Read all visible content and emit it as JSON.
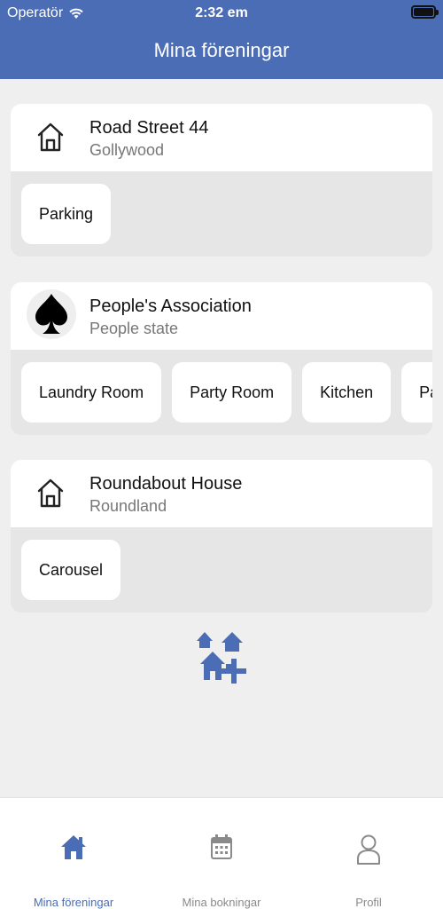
{
  "status_bar": {
    "carrier": "Operatör",
    "time": "2:32 em"
  },
  "header": {
    "title": "Mina föreningar"
  },
  "associations": [
    {
      "name": "Road Street 44",
      "location": "Gollywood",
      "icon": "house-icon",
      "resources": [
        "Parking"
      ]
    },
    {
      "name": "People's Association",
      "location": "People state",
      "icon": "spade-icon",
      "resources": [
        "Laundry Room",
        "Party Room",
        "Kitchen",
        "Par"
      ]
    },
    {
      "name": "Roundabout House",
      "location": "Roundland",
      "icon": "house-icon",
      "resources": [
        "Carousel"
      ]
    }
  ],
  "add_button": {
    "icon": "add-association-icon"
  },
  "tabbar": {
    "tabs": [
      {
        "label": "Mina föreningar",
        "icon": "home-icon",
        "active": true
      },
      {
        "label": "Mina bokningar",
        "icon": "calendar-icon",
        "active": false
      },
      {
        "label": "Profil",
        "icon": "user-icon",
        "active": false
      }
    ]
  },
  "colors": {
    "accent": "#4a6db5",
    "background": "#efefef",
    "inactive": "#8a8a8a"
  }
}
